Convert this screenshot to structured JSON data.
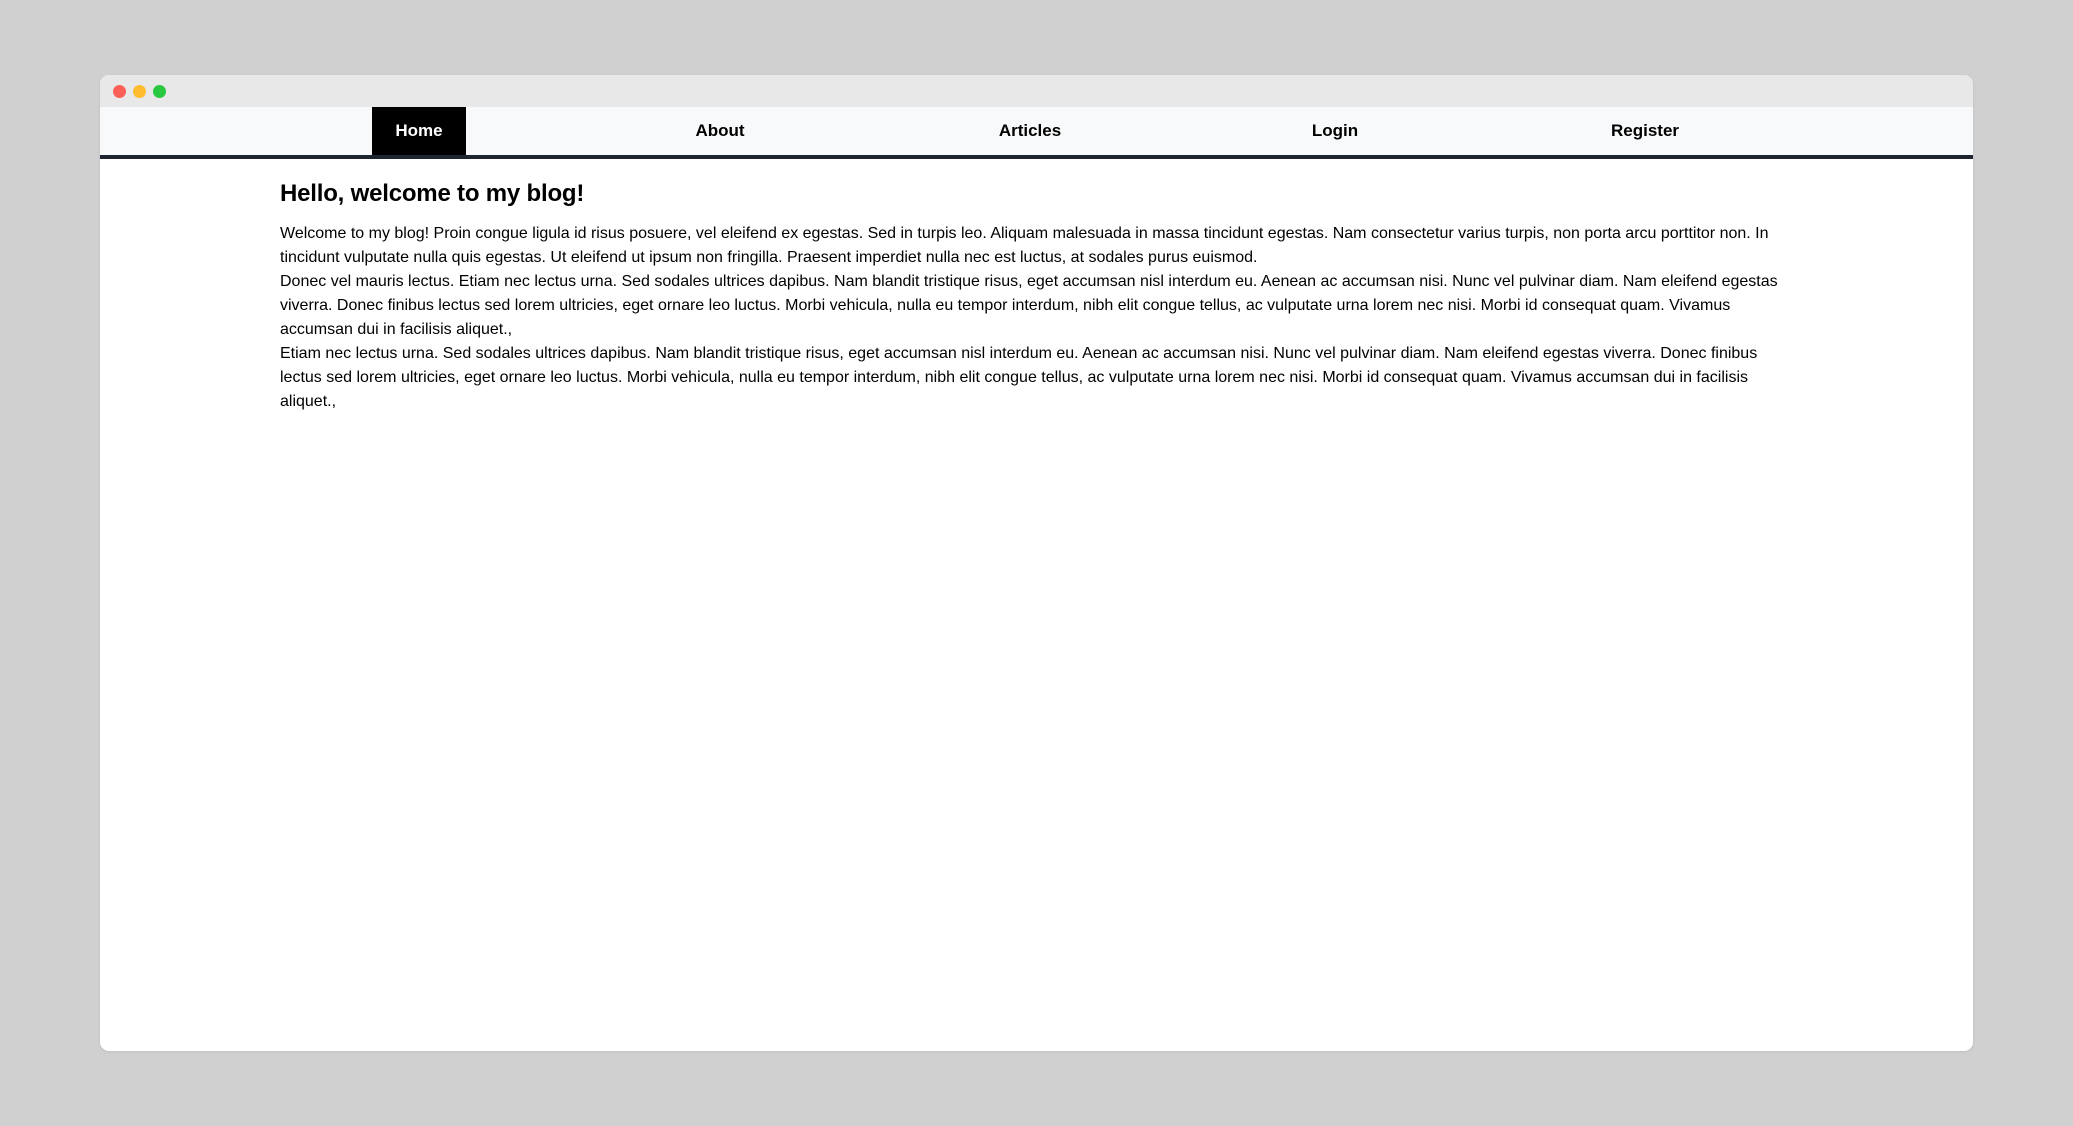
{
  "nav": {
    "items": [
      {
        "label": "Home",
        "active": true
      },
      {
        "label": "About",
        "active": false
      },
      {
        "label": "Articles",
        "active": false
      },
      {
        "label": "Login",
        "active": false
      },
      {
        "label": "Register",
        "active": false
      }
    ]
  },
  "main": {
    "title": "Hello, welcome to my blog!",
    "paragraphs": [
      "Welcome to my blog! Proin congue ligula id risus posuere, vel eleifend ex egestas. Sed in turpis leo. Aliquam malesuada in massa tincidunt egestas. Nam consectetur varius turpis, non porta arcu porttitor non. In tincidunt vulputate nulla quis egestas. Ut eleifend ut ipsum non fringilla. Praesent imperdiet nulla nec est luctus, at sodales purus euismod.",
      "Donec vel mauris lectus. Etiam nec lectus urna. Sed sodales ultrices dapibus. Nam blandit tristique risus, eget accumsan nisl interdum eu. Aenean ac accumsan nisi. Nunc vel pulvinar diam. Nam eleifend egestas viverra. Donec finibus lectus sed lorem ultricies, eget ornare leo luctus. Morbi vehicula, nulla eu tempor interdum, nibh elit congue tellus, ac vulputate urna lorem nec nisi. Morbi id consequat quam. Vivamus accumsan dui in facilisis aliquet.,",
      "Etiam nec lectus urna. Sed sodales ultrices dapibus. Nam blandit tristique risus, eget accumsan nisl interdum eu. Aenean ac accumsan nisi. Nunc vel pulvinar diam. Nam eleifend egestas viverra. Donec finibus lectus sed lorem ultricies, eget ornare leo luctus. Morbi vehicula, nulla eu tempor interdum, nibh elit congue tellus, ac vulputate urna lorem nec nisi. Morbi id consequat quam. Vivamus accumsan dui in facilisis aliquet.,"
    ]
  },
  "colors": {
    "page_background": "#d0d0d0",
    "titlebar": "#e8e8e8",
    "navbar_background": "#f8f9fa",
    "navbar_border": "#1e2430",
    "active_nav_background": "#000000",
    "active_nav_text": "#ffffff"
  }
}
